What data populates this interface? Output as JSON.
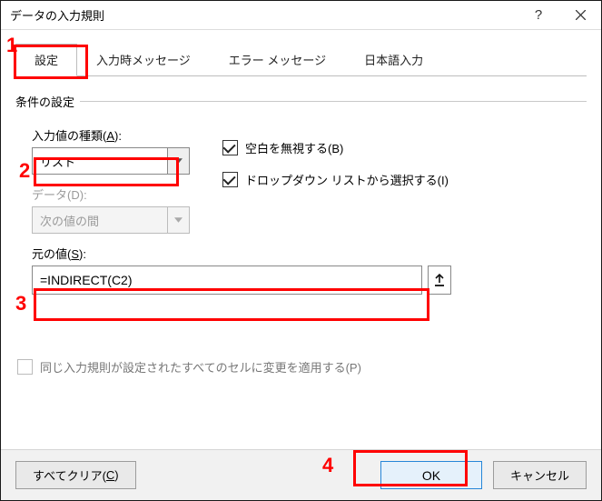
{
  "title": "データの入力規則",
  "tabs": {
    "settings": "設定",
    "inputMsg": "入力時メッセージ",
    "errorMsg": "エラー メッセージ",
    "ime": "日本語入力"
  },
  "group": {
    "label": "条件の設定"
  },
  "allow": {
    "label_pre": "入力値の種類(",
    "label_key": "A",
    "label_post": "):",
    "value": "リスト"
  },
  "data": {
    "label_pre": "データ(",
    "label_key": "D",
    "label_post": "):",
    "value": "次の値の間"
  },
  "ignoreBlank": {
    "label_pre": "空白を無視する(",
    "label_key": "B",
    "label_post": ")"
  },
  "dropdown": {
    "label_pre": "ドロップダウン リストから選択する(",
    "label_key": "I",
    "label_post": ")"
  },
  "source": {
    "label_pre": "元の値(",
    "label_key": "S",
    "label_post": "):",
    "value": "=INDIRECT(C2)"
  },
  "applyAll": {
    "label_pre": "同じ入力規則が設定されたすべてのセルに変更を適用する(",
    "label_key": "P",
    "label_post": ")"
  },
  "buttons": {
    "clearAll_pre": "すべてクリア(",
    "clearAll_key": "C",
    "clearAll_post": ")",
    "ok": "OK",
    "cancel": "キャンセル"
  },
  "annotations": {
    "n1": "1",
    "n2": "2",
    "n3": "3",
    "n4": "4"
  }
}
